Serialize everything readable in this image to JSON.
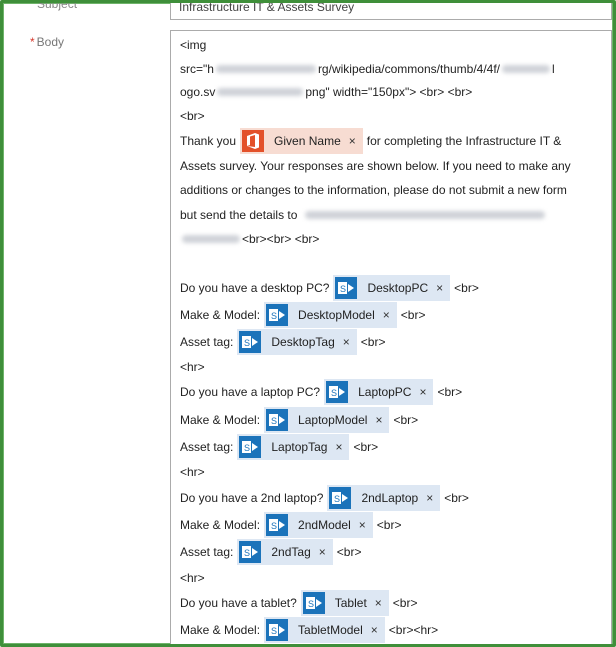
{
  "subject": {
    "label": "Subject",
    "value": "Infrastructure IT & Assets Survey"
  },
  "body_field": {
    "required_mark": "*",
    "label": "Body"
  },
  "body": {
    "img_line1": "<img",
    "img_line2_a": "src=\"h",
    "img_line2_b": "rg/wikipedia/commons/thumb/4/4f/",
    "img_line2_c": "l",
    "img_line3_a": "ogo.sv",
    "img_line3_b": "png\" width=\"150px\"> <br> <br>",
    "br": "<br>",
    "thanks_prefix": "Thank you",
    "given_name_token": "Given Name",
    "thanks_suffix": "for completing the Infrastructure IT &",
    "para2": "Assets survey. Your responses are shown below. If you need to make any",
    "para3": "additions or changes to the information, please do not submit a new form",
    "para4": "but send the details to",
    "para5_suffix": "<br><br> <br>",
    "desktop_q": "Do you have a desktop PC?",
    "desktop_token": "DesktopPC",
    "make_model": "Make & Model:",
    "desktop_model_token": "DesktopModel",
    "asset_tag": "Asset tag:",
    "desktop_tag_token": "DesktopTag",
    "hr": "<hr>",
    "laptop_q": "Do you have a laptop PC?",
    "laptop_token": "LaptopPC",
    "laptop_model_token": "LaptopModel",
    "laptop_tag_token": "LaptopTag",
    "laptop2_q": "Do you have a 2nd laptop?",
    "laptop2_token": "2ndLaptop",
    "laptop2_model_token": "2ndModel",
    "laptop2_tag_token": "2ndTag",
    "tablet_q": "Do you have a tablet?",
    "tablet_token": "Tablet",
    "tablet_model_token": "TabletModel",
    "br_hr": "<br><hr>"
  },
  "token_close": "×",
  "icons": {
    "office": "office-icon",
    "sharepoint": "sharepoint-icon"
  },
  "colors": {
    "frame": "#3f8f3a",
    "office": "#e3512a",
    "sharepoint": "#1b73ba",
    "token_bg": "#dde7f3",
    "office_token_bg": "#f7dcd2"
  }
}
